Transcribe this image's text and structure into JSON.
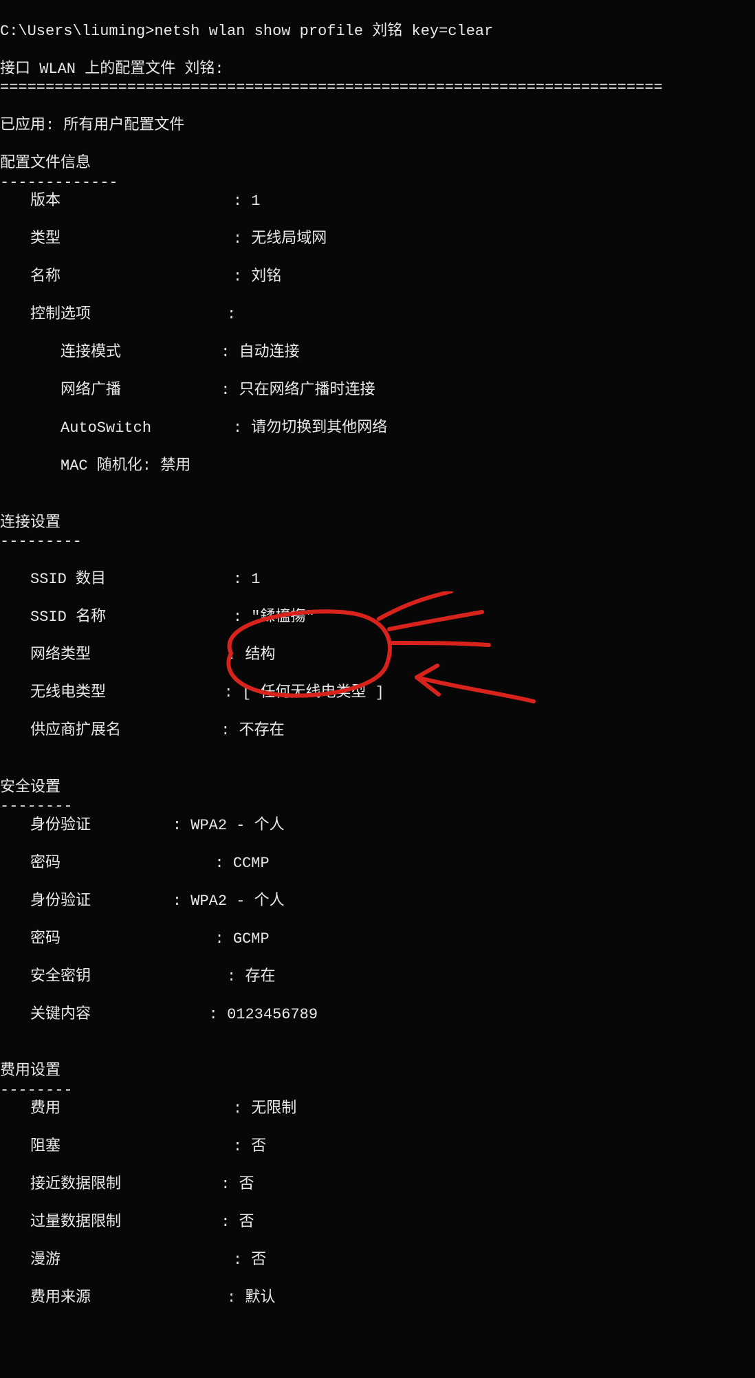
{
  "prompt": "C:\\Users\\liuming>netsh wlan show profile 刘铭 key=clear",
  "interface_line": "接口 WLAN 上的配置文件 刘铭:",
  "divider": "=========================================================================",
  "applied": "已应用: 所有用户配置文件",
  "section_profile": "配置文件信息",
  "dash_short": "-------------",
  "profile": {
    "version_lbl": "版本",
    "version": "1",
    "type_lbl": "类型",
    "type": "无线局域网",
    "name_lbl": "名称",
    "name": "刘铭",
    "ctrl_lbl": "控制选项",
    "ctrl": "",
    "connmode_lbl": "连接模式",
    "connmode": "自动连接",
    "broadcast_lbl": "网络广播",
    "broadcast": "只在网络广播时连接",
    "autoswitch_lbl": "AutoSwitch",
    "autoswitch": "请勿切换到其他网络",
    "macrand": "MAC 随机化: 禁用"
  },
  "section_conn": "连接设置",
  "dash_short2": "---------",
  "conn": {
    "ssidnum_lbl": "SSID 数目",
    "ssidnum": "1",
    "ssidname_lbl": "SSID 名称",
    "ssidname": "\"鍒橀摥\"",
    "nettype_lbl": "网络类型",
    "nettype": "结构",
    "radiotype_lbl": "无线电类型",
    "radiotype": "[ 任何无线电类型 ]",
    "vendor_lbl": "供应商扩展名",
    "vendor": "不存在"
  },
  "section_sec": "安全设置",
  "dash_short3": "--------",
  "sec": {
    "auth1_lbl": "身份验证",
    "auth1": "WPA2 - 个人",
    "cipher1_lbl": "密码",
    "cipher1": "CCMP",
    "auth2_lbl": "身份验证",
    "auth2": "WPA2 - 个人",
    "cipher2_lbl": "密码",
    "cipher2": "GCMP",
    "seckey_lbl": "安全密钥",
    "seckey": "存在",
    "keycontent_lbl": "关键内容",
    "keycontent": "0123456789"
  },
  "section_cost": "费用设置",
  "dash_short4": "--------",
  "cost": {
    "cost_lbl": "费用",
    "cost": "无限制",
    "congested_lbl": "阻塞",
    "congested": "否",
    "approaching_lbl": "接近数据限制",
    "approaching": "否",
    "over_lbl": "过量数据限制",
    "over": "否",
    "roaming_lbl": "漫游",
    "roaming": "否",
    "source_lbl": "费用来源",
    "source": "默认"
  }
}
